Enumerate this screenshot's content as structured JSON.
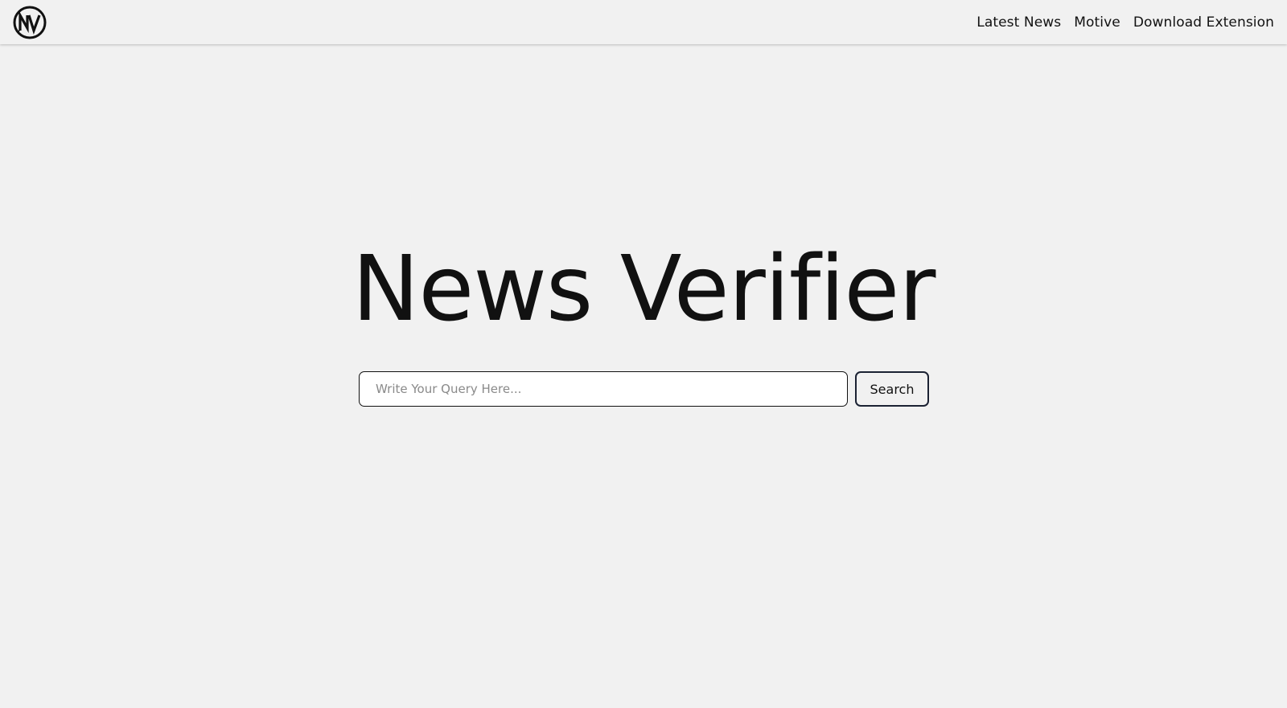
{
  "brand": {
    "logo_icon": "nv-logo-icon",
    "logo_text": "NV"
  },
  "nav": {
    "links": [
      {
        "label": "Latest News"
      },
      {
        "label": "Motive"
      },
      {
        "label": "Download Extension"
      }
    ]
  },
  "hero": {
    "title": "News Verifier"
  },
  "search": {
    "placeholder": "Write Your Query Here...",
    "value": "",
    "button_label": "Search",
    "icon": "none"
  },
  "colors": {
    "background": "#f1f1f1",
    "text": "#111111",
    "button_border": "#1b2233",
    "input_background": "#ffffff",
    "placeholder": "#8a8a8a"
  }
}
